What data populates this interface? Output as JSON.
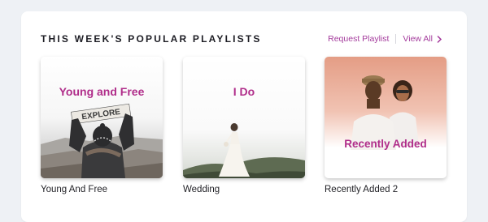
{
  "section": {
    "title": "THIS WEEK'S POPULAR PLAYLISTS",
    "request_label": "Request Playlist",
    "view_all_label": "View All"
  },
  "colors": {
    "accent": "#a43b9c",
    "cover_title": "#b02d8a"
  },
  "playlists": [
    {
      "cover_title": "Young and Free",
      "name": "Young And Free",
      "sign_text": "EXPLORE"
    },
    {
      "cover_title": "I Do",
      "name": "Wedding"
    },
    {
      "cover_title": "Recently Added",
      "name": "Recently Added 2"
    }
  ]
}
